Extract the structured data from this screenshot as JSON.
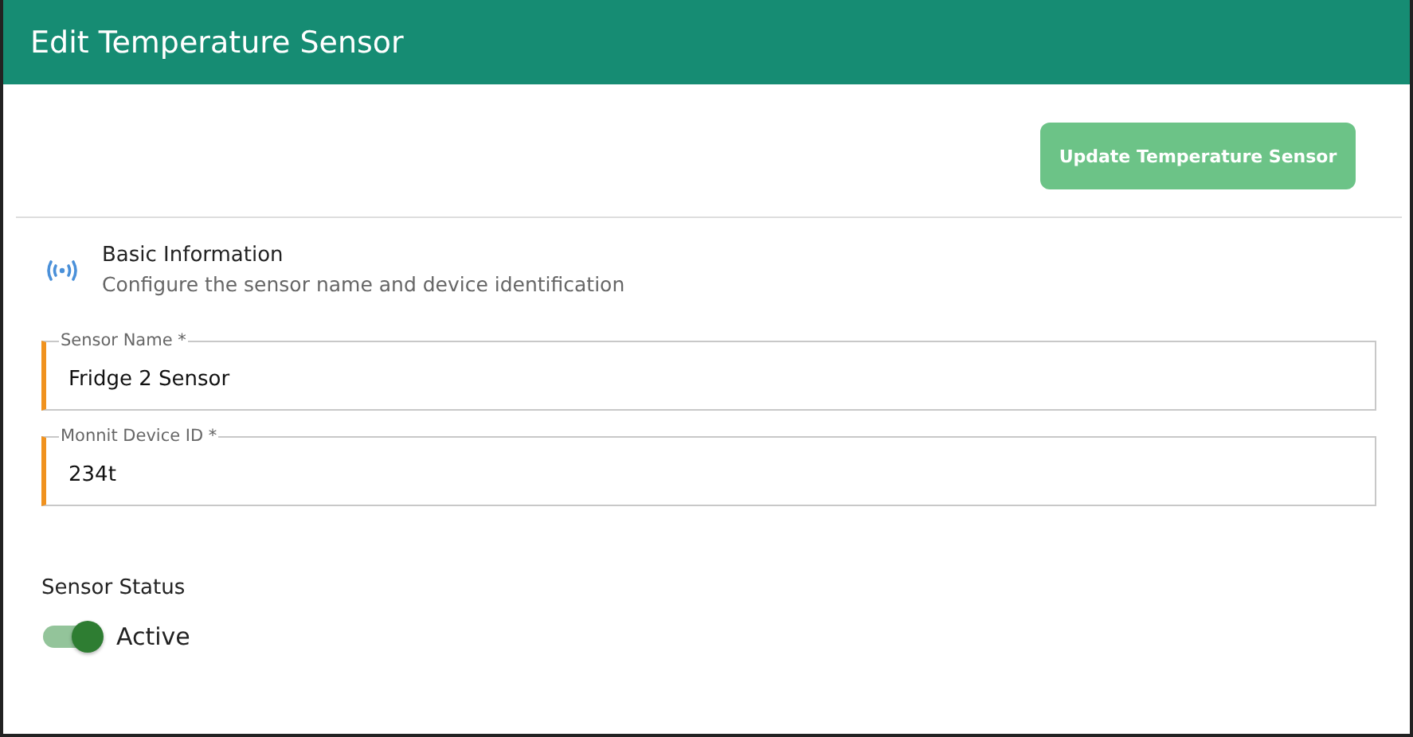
{
  "window": {
    "title": "Edit Temperature Sensor"
  },
  "actions": {
    "submit": {
      "label": "Update Temperature Sensor"
    }
  },
  "section": {
    "title": "Basic Information",
    "subtitle": "Configure the sensor name and device identification"
  },
  "fields": [
    {
      "label": "Sensor Name *",
      "value": "Fridge 2 Sensor"
    },
    {
      "label": "Monnit Device ID *",
      "value": "234t"
    }
  ],
  "status": {
    "label": "Sensor Status",
    "on": true,
    "text": "Active"
  }
}
